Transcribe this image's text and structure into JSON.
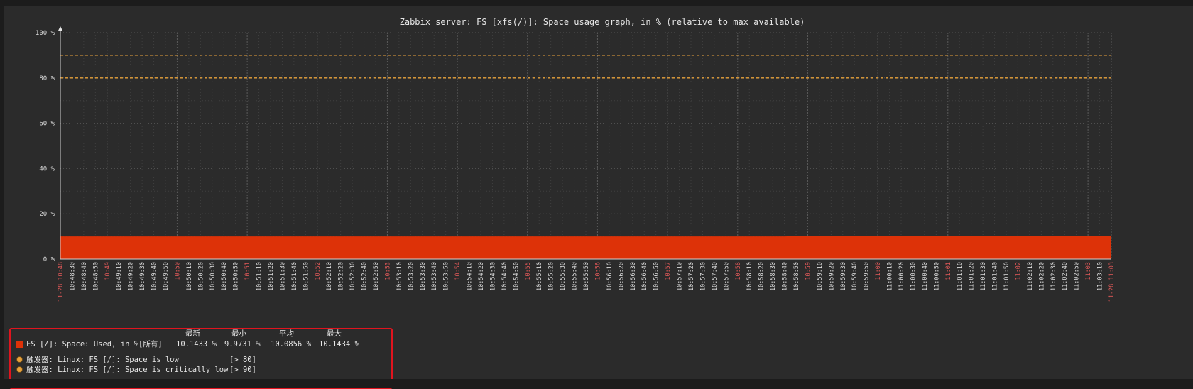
{
  "chart_data": {
    "type": "area",
    "title": "Zabbix server: FS [xfs(/)]: Space usage graph, in % (relative to max available)",
    "ylim": [
      0,
      100
    ],
    "yticks": [
      0,
      20,
      40,
      60,
      80,
      100
    ],
    "yticklabels": [
      "0 %",
      "20 %",
      "40 %",
      "60 %",
      "80 %",
      "100 %"
    ],
    "grid": true,
    "series": [
      {
        "name": "FS [/]: Space: Used, in %",
        "color": "#dd3208",
        "x": [
          "10:48:30",
          "10:58:40",
          "10:58:50",
          "11:03:10"
        ],
        "values": [
          9.9731,
          10.0,
          10.1433,
          10.1434
        ]
      }
    ],
    "thresholds": [
      {
        "value": 80,
        "color": "#e8a23b"
      },
      {
        "value": 90,
        "color": "#e8a23b"
      }
    ],
    "xticks": [
      {
        "label": "11-28 10:48",
        "major": true
      },
      {
        "label": "10:48:30"
      },
      {
        "label": "10:48:40"
      },
      {
        "label": "10:48:50"
      },
      {
        "label": "10:49",
        "major": true
      },
      {
        "label": "10:49:10"
      },
      {
        "label": "10:49:20"
      },
      {
        "label": "10:49:30"
      },
      {
        "label": "10:49:40"
      },
      {
        "label": "10:49:50"
      },
      {
        "label": "10:50",
        "major": true
      },
      {
        "label": "10:50:10"
      },
      {
        "label": "10:50:20"
      },
      {
        "label": "10:50:30"
      },
      {
        "label": "10:50:40"
      },
      {
        "label": "10:50:50"
      },
      {
        "label": "10:51",
        "major": true
      },
      {
        "label": "10:51:10"
      },
      {
        "label": "10:51:20"
      },
      {
        "label": "10:51:30"
      },
      {
        "label": "10:51:40"
      },
      {
        "label": "10:51:50"
      },
      {
        "label": "10:52",
        "major": true
      },
      {
        "label": "10:52:10"
      },
      {
        "label": "10:52:20"
      },
      {
        "label": "10:52:30"
      },
      {
        "label": "10:52:40"
      },
      {
        "label": "10:52:50"
      },
      {
        "label": "10:53",
        "major": true
      },
      {
        "label": "10:53:10"
      },
      {
        "label": "10:53:20"
      },
      {
        "label": "10:53:30"
      },
      {
        "label": "10:53:40"
      },
      {
        "label": "10:53:50"
      },
      {
        "label": "10:54",
        "major": true
      },
      {
        "label": "10:54:10"
      },
      {
        "label": "10:54:20"
      },
      {
        "label": "10:54:30"
      },
      {
        "label": "10:54:40"
      },
      {
        "label": "10:54:50"
      },
      {
        "label": "10:55",
        "major": true
      },
      {
        "label": "10:55:10"
      },
      {
        "label": "10:55:20"
      },
      {
        "label": "10:55:30"
      },
      {
        "label": "10:55:40"
      },
      {
        "label": "10:55:50"
      },
      {
        "label": "10:56",
        "major": true
      },
      {
        "label": "10:56:10"
      },
      {
        "label": "10:56:20"
      },
      {
        "label": "10:56:30"
      },
      {
        "label": "10:56:40"
      },
      {
        "label": "10:56:50"
      },
      {
        "label": "10:57",
        "major": true
      },
      {
        "label": "10:57:10"
      },
      {
        "label": "10:57:20"
      },
      {
        "label": "10:57:30"
      },
      {
        "label": "10:57:40"
      },
      {
        "label": "10:57:50"
      },
      {
        "label": "10:58",
        "major": true
      },
      {
        "label": "10:58:10"
      },
      {
        "label": "10:58:20"
      },
      {
        "label": "10:58:30"
      },
      {
        "label": "10:58:40"
      },
      {
        "label": "10:58:50"
      },
      {
        "label": "10:59",
        "major": true
      },
      {
        "label": "10:59:10"
      },
      {
        "label": "10:59:20"
      },
      {
        "label": "10:59:30"
      },
      {
        "label": "10:59:40"
      },
      {
        "label": "10:59:50"
      },
      {
        "label": "11:00",
        "major": true
      },
      {
        "label": "11:00:10"
      },
      {
        "label": "11:00:20"
      },
      {
        "label": "11:00:30"
      },
      {
        "label": "11:00:40"
      },
      {
        "label": "11:00:50"
      },
      {
        "label": "11:01",
        "major": true
      },
      {
        "label": "11:01:10"
      },
      {
        "label": "11:01:20"
      },
      {
        "label": "11:01:30"
      },
      {
        "label": "11:01:40"
      },
      {
        "label": "11:01:50"
      },
      {
        "label": "11:02",
        "major": true
      },
      {
        "label": "11:02:10"
      },
      {
        "label": "11:02:20"
      },
      {
        "label": "11:02:30"
      },
      {
        "label": "11:02:40"
      },
      {
        "label": "11:02:50"
      },
      {
        "label": "11:03",
        "major": true
      },
      {
        "label": "11:03:10"
      },
      {
        "label": "11-28 11:03",
        "major": true
      }
    ]
  },
  "legend": {
    "headers": {
      "last": "最新",
      "min": "最小",
      "avg": "平均",
      "max": "最大"
    },
    "item": {
      "label": "FS [/]: Space: Used, in %",
      "func": "[所有]",
      "last": "10.1433 %",
      "min": "9.9731 %",
      "avg": "10.0856 %",
      "max": "10.1434 %"
    },
    "triggers": [
      {
        "label": "触发器: Linux: FS [/]: Space is low",
        "cond": "[> 80]"
      },
      {
        "label": "触发器: Linux: FS [/]: Space is critically low",
        "cond": "[> 90]"
      }
    ]
  },
  "colors": {
    "series": "#dd3208",
    "trigger": "#e8a23b",
    "major_tick": "#e45959",
    "tick": "#dcdcdc",
    "legend_border": "#e0141e"
  }
}
